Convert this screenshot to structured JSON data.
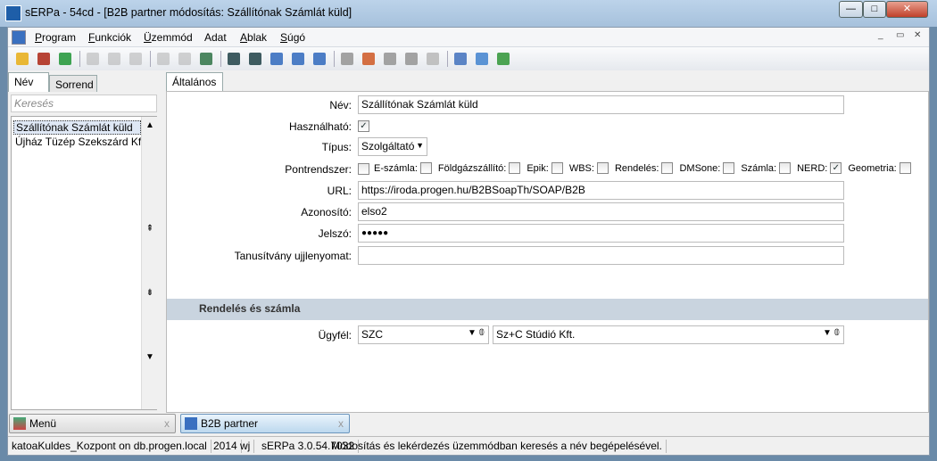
{
  "window": {
    "title": "sERPa - 54cd - [B2B partner módosítás: Szállítónak Számlát küld]",
    "min": "—",
    "max": "□",
    "close": "✕",
    "child_min": "_",
    "child_restore": "▭",
    "child_close": "✕"
  },
  "menu": [
    {
      "u": "P",
      "rest": "rogram"
    },
    {
      "u": "F",
      "rest": "unkciók"
    },
    {
      "u": "Ü",
      "rest": "zemmód"
    },
    {
      "u": "",
      "rest": "Adat"
    },
    {
      "u": "A",
      "rest": "blak"
    },
    {
      "u": "S",
      "rest": "úgó"
    }
  ],
  "toolbar_icons": [
    "new-icon",
    "edit-icon",
    "refresh-icon",
    "print-icon",
    "print-preview-icon",
    "attach-icon",
    "save-icon",
    "delete-icon",
    "save-close-icon",
    "filter-icon",
    "filter-doc-icon",
    "search-icon",
    "up-icon",
    "down-icon",
    "indent-icon",
    "report-icon",
    "move-left-icon",
    "move-right-icon",
    "help-icon",
    "calculator-icon",
    "mail-icon",
    "phone-icon"
  ],
  "left": {
    "tabs": [
      "Név",
      "Sorrend"
    ],
    "search_placeholder": "Keresés",
    "items": [
      "Szállítónak Számlát küld",
      "Újház Tüzép Szekszárd Kft."
    ],
    "scroll": [
      "▲",
      "⇞",
      "⇟",
      "▼"
    ]
  },
  "right": {
    "tab": "Általános",
    "form": {
      "nev_label": "Név:",
      "nev": "Szállítónak Számlát küld",
      "hasznalhato_label": "Használható:",
      "hasznalhato": true,
      "tipus_label": "Típus:",
      "tipus": "Szolgáltató",
      "pontrendszer_label": "Pontrendszer:",
      "checks": [
        {
          "label": "E-számla:",
          "checked": false
        },
        {
          "label": "Földgázszállító:",
          "checked": false
        },
        {
          "label": "Epik:",
          "checked": false
        },
        {
          "label": "WBS:",
          "checked": false
        },
        {
          "label": "Rendelés:",
          "checked": false
        },
        {
          "label": "DMSone:",
          "checked": false
        },
        {
          "label": "Számla:",
          "checked": false
        },
        {
          "label": "NERD:",
          "checked": true
        },
        {
          "label": "Geometria:",
          "checked": false
        }
      ],
      "pontrendszer_checked": false,
      "url_label": "URL:",
      "url": "https://iroda.progen.hu/B2BSoapTh/SOAP/B2B",
      "azonosito_label": "Azonosító:",
      "azonosito": "elso2",
      "jelszo_label": "Jelszó:",
      "jelszo": "●●●●●",
      "tanusitvany_label": "Tanusítvány ujjlenyomat:",
      "tanusitvany": ""
    },
    "section": "Rendelés és számla",
    "ugyfel_label": "Ügyfél:",
    "ugyfel_code": "SZC",
    "ugyfel_name": "Sz+C Stúdió Kft."
  },
  "bottom_tabs": [
    {
      "label": "Menü",
      "close": "x"
    },
    {
      "label": "B2B partner",
      "close": "x"
    }
  ],
  "status": [
    "katoaKuldes_Kozpont on db.progen.local",
    "2014",
    "wj",
    "sERPa 3.0.54.7032",
    "Módosítás és lekérdezés üzemmódban keresés a név begépelésével."
  ]
}
